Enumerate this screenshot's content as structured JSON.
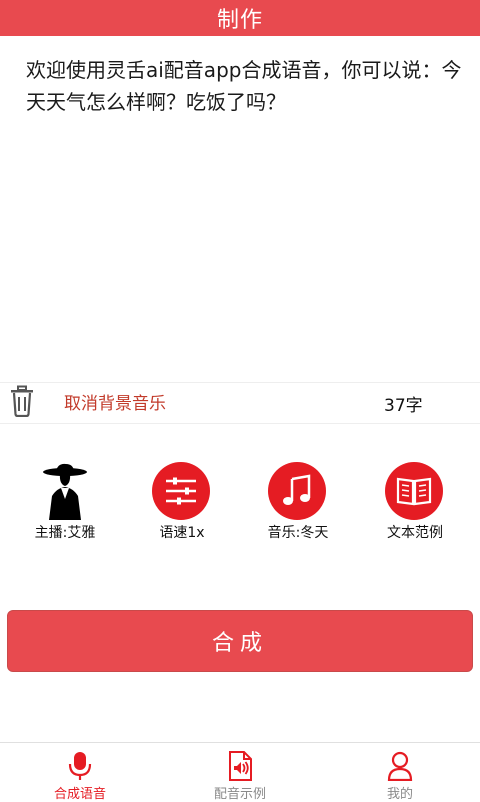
{
  "header": {
    "title": "制作"
  },
  "editor": {
    "text": "欢迎使用灵舌ai配音app合成语音，你可以说：今天天气怎么样啊？吃饭了吗？"
  },
  "toolbar": {
    "cancel_bgm_label": "取消背景音乐",
    "char_count": "37字"
  },
  "options": [
    {
      "label": "主播:艾雅",
      "icon": "anchor-avatar-icon"
    },
    {
      "label": "语速1x",
      "icon": "sliders-icon"
    },
    {
      "label": "音乐:冬天",
      "icon": "music-note-icon"
    },
    {
      "label": "文本范例",
      "icon": "book-icon"
    }
  ],
  "compose_button": {
    "label": "合成"
  },
  "bottom_nav": [
    {
      "label": "合成语音",
      "icon": "microphone-icon",
      "active": true
    },
    {
      "label": "配音示例",
      "icon": "audio-file-icon",
      "active": false
    },
    {
      "label": "我的",
      "icon": "user-icon",
      "active": false
    }
  ],
  "colors": {
    "accent": "#e84a4f",
    "icon_red": "#e51c23",
    "cancel_text": "#c23a2a",
    "nav_inactive": "#8a8a8a"
  }
}
